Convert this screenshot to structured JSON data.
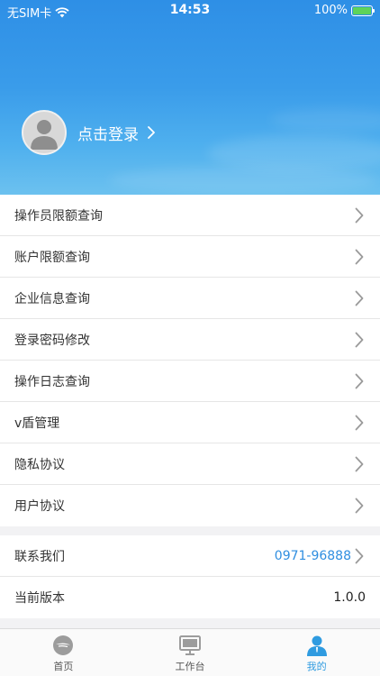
{
  "status_bar": {
    "carrier": "无SIM卡",
    "time": "14:53",
    "battery": "100%"
  },
  "profile": {
    "login_label": "点击登录"
  },
  "menu_items": [
    {
      "label": "操作员限额查询"
    },
    {
      "label": "账户限额查询"
    },
    {
      "label": "企业信息查询"
    },
    {
      "label": "登录密码修改"
    },
    {
      "label": "操作日志查询"
    },
    {
      "label": "v盾管理"
    },
    {
      "label": "隐私协议"
    },
    {
      "label": "用户协议"
    }
  ],
  "info_items": [
    {
      "label": "联系我们",
      "value": "0971-96888"
    },
    {
      "label": "当前版本",
      "value": "1.0.0"
    }
  ],
  "tabs": [
    {
      "label": "首页",
      "icon": "home-icon",
      "active": false
    },
    {
      "label": "工作台",
      "icon": "monitor-icon",
      "active": false
    },
    {
      "label": "我的",
      "icon": "user-icon",
      "active": true
    }
  ],
  "colors": {
    "accent": "#2f9be0",
    "link_value": "#2f8ee0",
    "inactive_tab": "#555555",
    "chevron": "#9a9a9a"
  }
}
